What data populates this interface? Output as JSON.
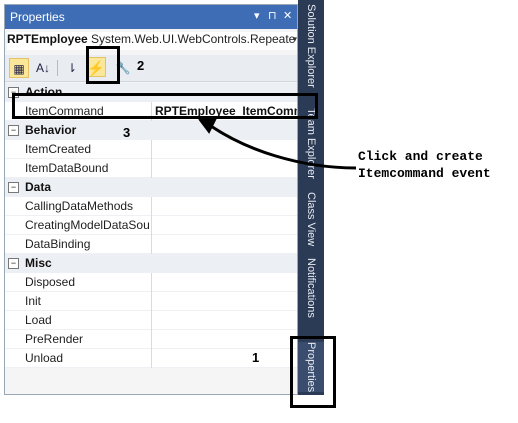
{
  "panel": {
    "title": "Properties",
    "controls": {
      "dropdown": "▾",
      "pin": "⊓",
      "close": "✕"
    },
    "selector": {
      "name": "RPTEmployee",
      "type": "System.Web.UI.WebControls.Repeate",
      "dropdown": "▾"
    },
    "toolbar": {
      "categorized": "▦",
      "alphabetical": "A↓",
      "property_pages": "⇂",
      "events": "⚡",
      "properties": "🔧"
    }
  },
  "grid": {
    "categories": [
      {
        "label": "Action",
        "expander": "−",
        "items": [
          {
            "name": "ItemCommand",
            "value": "RPTEmployee_ItemComma"
          }
        ]
      },
      {
        "label": "Behavior",
        "expander": "−",
        "items": [
          {
            "name": "ItemCreated",
            "value": ""
          },
          {
            "name": "ItemDataBound",
            "value": ""
          }
        ]
      },
      {
        "label": "Data",
        "expander": "−",
        "items": [
          {
            "name": "CallingDataMethods",
            "value": ""
          },
          {
            "name": "CreatingModelDataSou",
            "value": ""
          },
          {
            "name": "DataBinding",
            "value": ""
          }
        ]
      },
      {
        "label": "Misc",
        "expander": "−",
        "items": [
          {
            "name": "Disposed",
            "value": ""
          },
          {
            "name": "Init",
            "value": ""
          },
          {
            "name": "Load",
            "value": ""
          },
          {
            "name": "PreRender",
            "value": ""
          },
          {
            "name": "Unload",
            "value": ""
          }
        ]
      }
    ]
  },
  "side_tabs": [
    "Solution Explorer",
    "Team Explorer",
    "Class View",
    "Notifications",
    "Properties"
  ],
  "annotations": {
    "num1": "1",
    "num2": "2",
    "num3": "3",
    "note_line1": "Click and create",
    "note_line2": "Itemcommand event"
  },
  "colors": {
    "title_bar": "#3e6db5",
    "side_tabs": "#2b3a55",
    "selected_button": "#fbe79a"
  }
}
